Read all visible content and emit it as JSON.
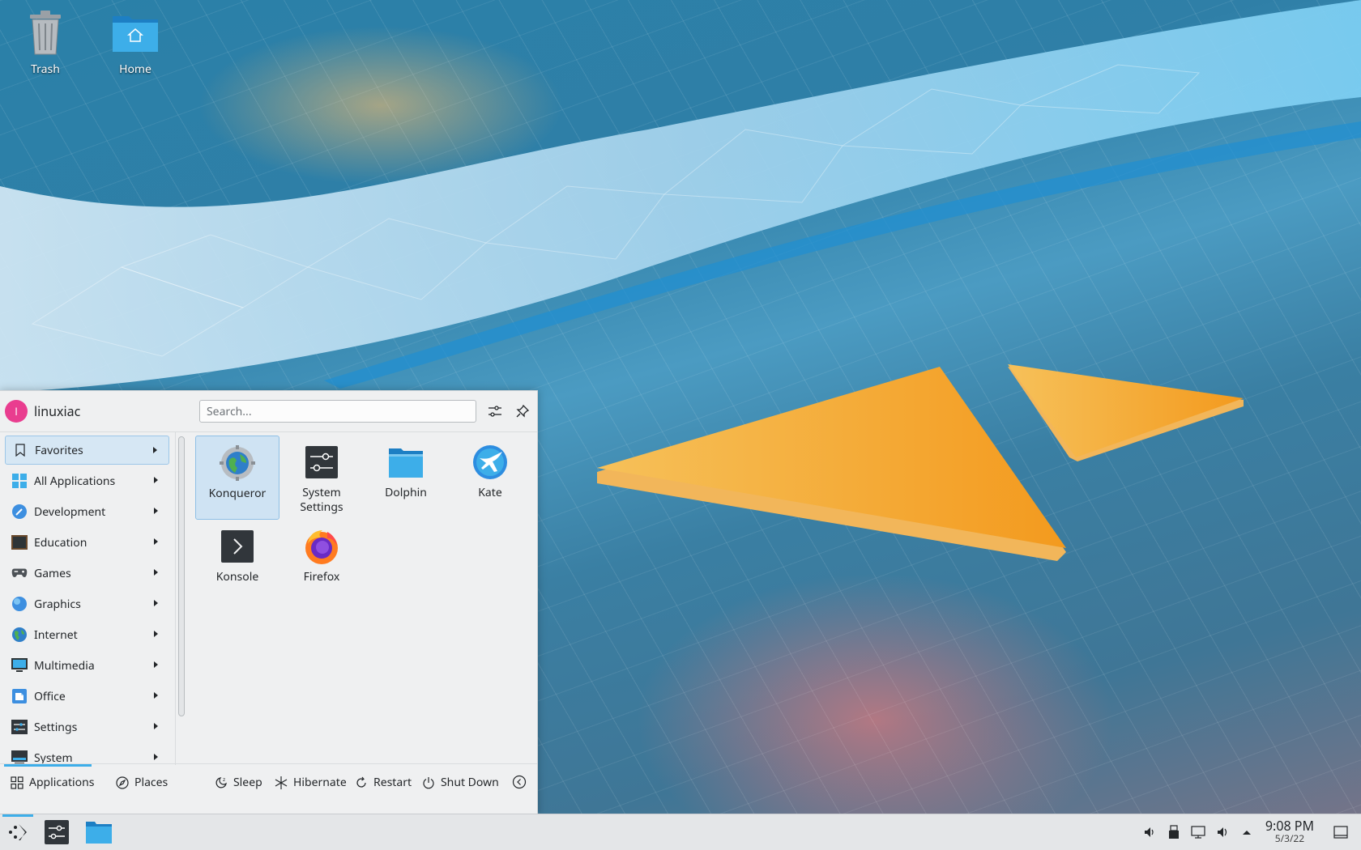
{
  "desktop": {
    "icons": [
      {
        "label": "Trash",
        "icon": "trash-icon"
      },
      {
        "label": "Home",
        "icon": "home-folder-icon"
      }
    ]
  },
  "menu": {
    "user": {
      "initial": "l",
      "name": "linuxiac"
    },
    "search": {
      "placeholder": "Search..."
    },
    "categories": [
      {
        "label": "Favorites",
        "icon": "bookmark-icon"
      },
      {
        "label": "All Applications",
        "icon": "grid-icon"
      },
      {
        "label": "Development",
        "icon": "development-icon"
      },
      {
        "label": "Education",
        "icon": "education-icon"
      },
      {
        "label": "Games",
        "icon": "gamepad-icon"
      },
      {
        "label": "Graphics",
        "icon": "graphics-icon"
      },
      {
        "label": "Internet",
        "icon": "globe-icon"
      },
      {
        "label": "Multimedia",
        "icon": "multimedia-icon"
      },
      {
        "label": "Office",
        "icon": "office-icon"
      },
      {
        "label": "Settings",
        "icon": "settings-icon"
      },
      {
        "label": "System",
        "icon": "system-icon"
      }
    ],
    "apps": [
      {
        "label": "Konqueror",
        "icon": "konqueror-icon"
      },
      {
        "label": "System Settings",
        "line1": "System",
        "line2": "Settings",
        "icon": "system-settings-icon"
      },
      {
        "label": "Dolphin",
        "icon": "dolphin-icon"
      },
      {
        "label": "Kate",
        "icon": "kate-icon"
      },
      {
        "label": "Konsole",
        "icon": "konsole-icon"
      },
      {
        "label": "Firefox",
        "icon": "firefox-icon"
      }
    ],
    "footer": {
      "applications": "Applications",
      "places": "Places",
      "sleep": "Sleep",
      "hibernate": "Hibernate",
      "restart": "Restart",
      "shutdown": "Shut Down"
    }
  },
  "taskbar": {
    "clock": {
      "time": "9:08 PM",
      "date": "5/3/22"
    }
  },
  "colors": {
    "accent": "#3daee9",
    "avatar": "#e93d8f",
    "menu_bg": "#eff0f1"
  }
}
